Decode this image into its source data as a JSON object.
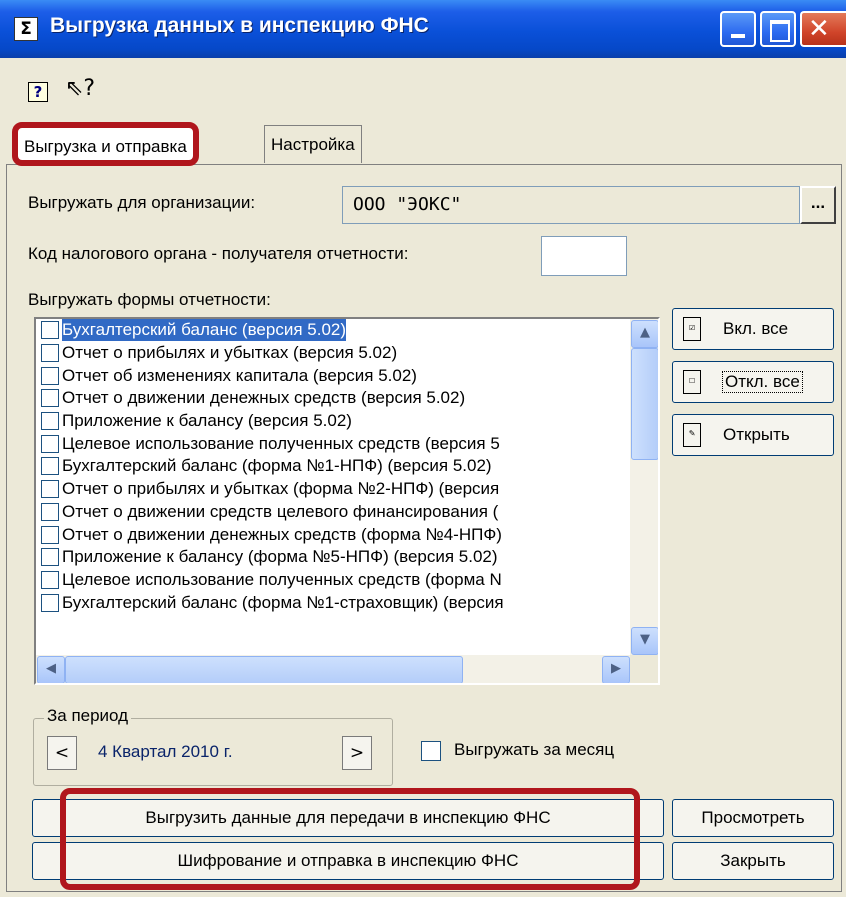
{
  "window": {
    "title": "Выгрузка данных в инспекцию ФНС",
    "app_icon_glyph": "Σ"
  },
  "toolbar": {
    "help_glyph": "?",
    "context_help_glyph": "⇖?"
  },
  "tabs": [
    {
      "label": "Выгрузка и отправка",
      "active": true
    },
    {
      "label": "Настройка",
      "active": false
    }
  ],
  "fields": {
    "org_label": "Выгружать для организации:",
    "org_value": "ООО \"ЭОКС\"",
    "org_button": "...",
    "tax_code_label": "Код налогового органа - получателя отчетности:",
    "tax_code_value": ""
  },
  "forms": {
    "label": "Выгружать формы отчетности:",
    "items": [
      "Бухгалтерский баланс (версия 5.02)",
      "Отчет о прибылях и убытках (версия 5.02)",
      "Отчет об изменениях капитала (версия 5.02)",
      "Отчет о движении денежных средств (версия 5.02)",
      "Приложение к балансу (версия 5.02)",
      "Целевое использование полученных средств (версия 5",
      "Бухгалтерский баланс (форма №1-НПФ) (версия 5.02)",
      "Отчет о прибылях и убытках (форма №2-НПФ) (версия",
      "Отчет о движении средств целевого финансирования (",
      "Отчет о движении денежных средств (форма №4-НПФ)",
      "Приложение к балансу (форма №5-НПФ) (версия 5.02)",
      "Целевое использование полученных средств (форма N",
      "Бухгалтерский баланс (форма №1-страховщик) (версия"
    ],
    "selected_index": 0
  },
  "side_buttons": {
    "select_all": "Вкл. все",
    "deselect_all": "Откл. все",
    "open": "Открыть"
  },
  "period": {
    "legend": "За период",
    "prev": "<",
    "next": ">",
    "value": "4 Квартал 2010 г.",
    "month_label": "Выгружать за месяц"
  },
  "actions": {
    "export": "Выгрузить данные для передачи в инспекцию ФНС",
    "encrypt_send": "Шифрование и отправка в инспекцию ФНС",
    "view": "Просмотреть",
    "close": "Закрыть"
  },
  "colors": {
    "highlight": "#b0161c",
    "titlebar": "#0a50d8",
    "selection": "#316ac5"
  }
}
